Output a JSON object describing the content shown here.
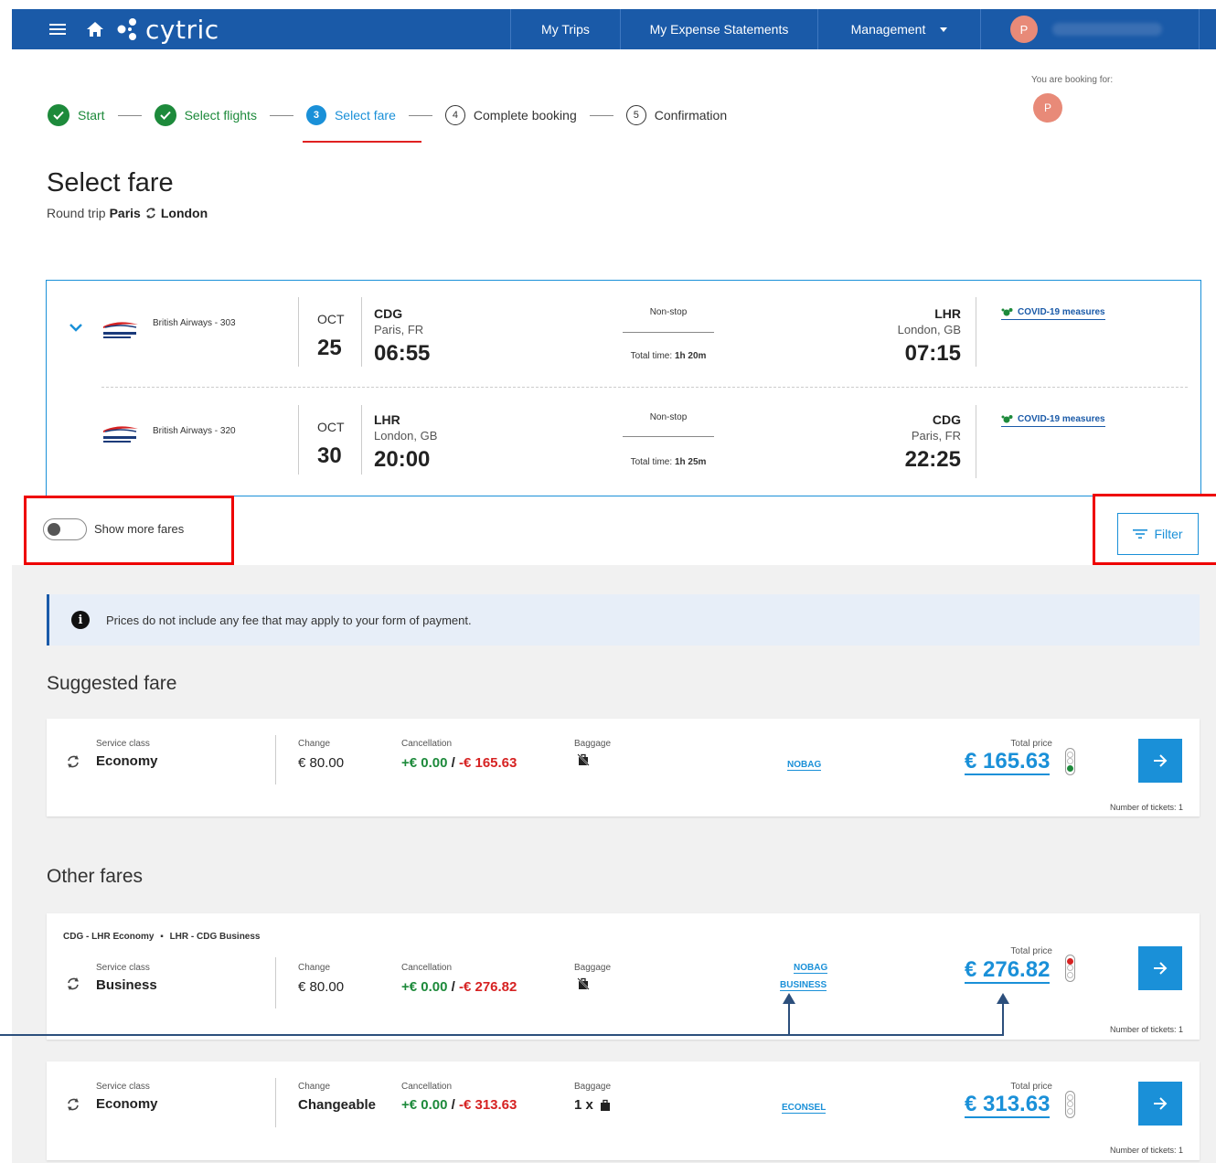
{
  "topbar": {
    "brand": "cytric",
    "nav": {
      "trips": "My Trips",
      "expense": "My Expense Statements",
      "management": "Management"
    },
    "user_initial": "P"
  },
  "booking_for": {
    "label": "You are booking for:",
    "initial": "P"
  },
  "stepper": [
    {
      "label": "Start",
      "state": "done"
    },
    {
      "label": "Select flights",
      "state": "done"
    },
    {
      "label": "Select fare",
      "number": "3",
      "state": "active"
    },
    {
      "label": "Complete booking",
      "number": "4",
      "state": "todo"
    },
    {
      "label": "Confirmation",
      "number": "5",
      "state": "todo"
    }
  ],
  "page": {
    "title": "Select fare",
    "subtitle_prefix": "Round trip",
    "origin": "Paris",
    "destination": "London"
  },
  "flights": [
    {
      "airline": "British Airways - 303",
      "month": "OCT",
      "day": "25",
      "dep_code": "CDG",
      "dep_city": "Paris, FR",
      "dep_time": "06:55",
      "stops": "Non-stop",
      "total_label": "Total time:",
      "total_value": "1h 20m",
      "arr_code": "LHR",
      "arr_city": "London, GB",
      "arr_time": "07:15",
      "covid": "COVID-19 measures"
    },
    {
      "airline": "British Airways - 320",
      "month": "OCT",
      "day": "30",
      "dep_code": "LHR",
      "dep_city": "London, GB",
      "dep_time": "20:00",
      "stops": "Non-stop",
      "total_label": "Total time:",
      "total_value": "1h 25m",
      "arr_code": "CDG",
      "arr_city": "Paris, FR",
      "arr_time": "22:25",
      "covid": "COVID-19 measures"
    }
  ],
  "controls": {
    "show_more_fares": "Show more fares",
    "filter": "Filter"
  },
  "info_banner": "Prices do not include any fee that may apply to your form of payment.",
  "labels": {
    "service_class": "Service class",
    "change": "Change",
    "cancellation": "Cancellation",
    "baggage": "Baggage",
    "total_price": "Total price",
    "tickets": "Number of tickets: 1"
  },
  "suggested": {
    "title": "Suggested fare",
    "service_class": "Economy",
    "change": "€ 80.00",
    "cancel_plus": "+€ 0.00",
    "cancel_sep": "/",
    "cancel_minus": "-€ 165.63",
    "fare_code": "NOBAG",
    "price": "€ 165.63",
    "light": "green"
  },
  "other": {
    "title": "Other fares",
    "fares": [
      {
        "route_a": "CDG - LHR",
        "class_a": "Economy",
        "route_b": "LHR - CDG",
        "class_b": "Business",
        "service_class": "Business",
        "change": "€ 80.00",
        "cancel_plus": "+€ 0.00",
        "cancel_sep": "/",
        "cancel_minus": "-€ 276.82",
        "fare_code_1": "NOBAG",
        "fare_code_2": "BUSINESS",
        "price": "€ 276.82",
        "light": "red"
      },
      {
        "service_class": "Economy",
        "change": "Changeable",
        "cancel_plus": "+€ 0.00",
        "cancel_sep": "/",
        "cancel_minus": "-€ 313.63",
        "baggage": "1 x",
        "fare_code": "ECONSEL",
        "price": "€ 313.63",
        "light": "off"
      }
    ]
  },
  "colors": {
    "nav": "#1a5aa8",
    "accent": "#1a90d8",
    "done": "#1d8a3b",
    "cancel_red": "#d62222",
    "highlight": "#e00000"
  }
}
